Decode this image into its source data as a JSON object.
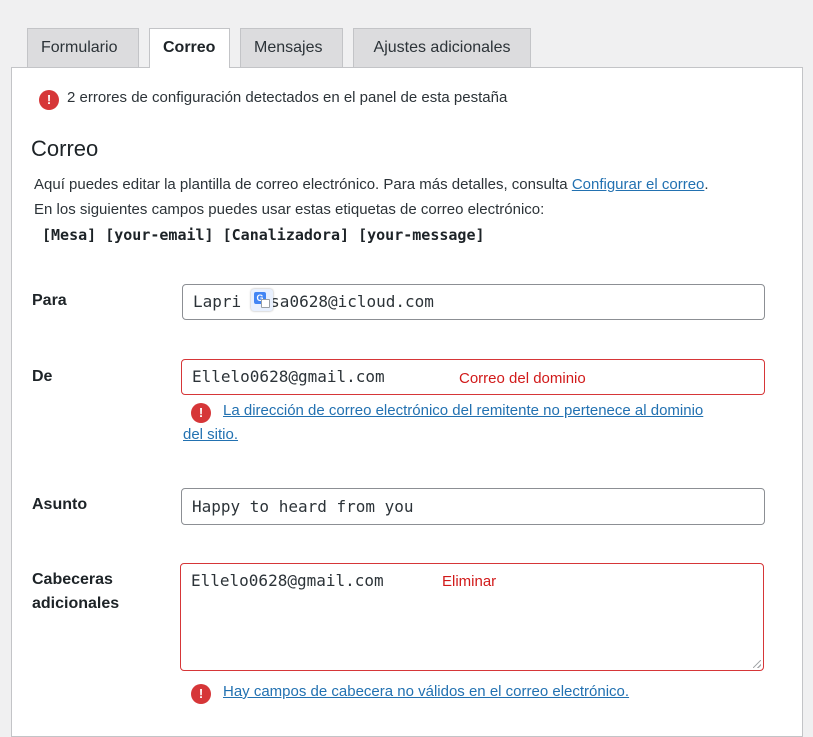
{
  "tabs": [
    {
      "label": "Formulario",
      "active": false
    },
    {
      "label": "Correo",
      "active": true
    },
    {
      "label": "Mensajes",
      "active": false
    },
    {
      "label": "Ajustes adicionales",
      "active": false
    }
  ],
  "config_warning": "2 errores de configuración detectados en el panel de esta pestaña",
  "section_title": "Correo",
  "description": {
    "line1_prefix": "Aquí puedes editar la plantilla de correo electrónico. Para más detalles, consulta ",
    "link": "Configurar el correo",
    "line1_suffix": ".",
    "line2": "En los siguientes campos puedes usar estas etiquetas de correo electrónico:",
    "tags": "[Mesa] [your-email] [Canalizadora] [your-message]"
  },
  "fields": {
    "para": {
      "label": "Para",
      "value_start": "Lapri",
      "value_end": "sa0628@icloud.com"
    },
    "de": {
      "label": "De",
      "value": "Ellelo0628@gmail.com",
      "annotation": "Correo del dominio",
      "error_line1": "La dirección de correo electrónico del remitente no pertenece al dominio",
      "error_line2": "del sitio."
    },
    "asunto": {
      "label": "Asunto",
      "value": "Happy to heard from you"
    },
    "cabeceras": {
      "label_line1": "Cabeceras",
      "label_line2": "adicionales",
      "value": "Ellelo0628@gmail.com",
      "annotation": "Eliminar",
      "error": "Hay campos de cabecera no válidos en el correo electrónico."
    }
  },
  "icons": {
    "error": "exclamation-circle-icon",
    "translate": "translate-icon"
  },
  "colors": {
    "error": "#d63638",
    "link": "#2271b1",
    "annotation": "#d11a1a",
    "panel_background": "#ffffff",
    "page_background": "#f0f0f1"
  }
}
